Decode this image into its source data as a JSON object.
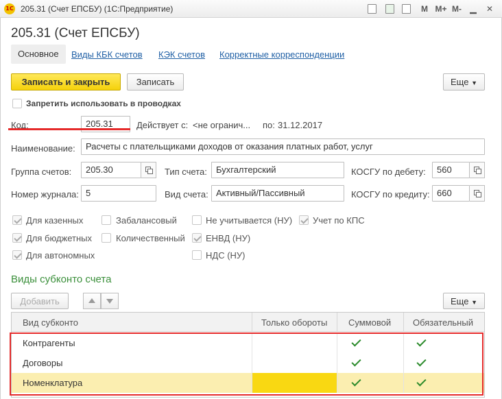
{
  "window": {
    "title": "205.31 (Счет ЕПСБУ)  (1С:Предприятие)",
    "logo": "1С",
    "toolbar": {
      "m": "M",
      "mplus": "M+",
      "mminus": "M-"
    }
  },
  "form": {
    "heading": "205.31 (Счет ЕПСБУ)",
    "tabs": [
      "Основное",
      "Виды КБК счетов",
      "КЭК счетов",
      "Корректные корреспонденции"
    ],
    "buttons": {
      "save_close": "Записать и закрыть",
      "save": "Записать",
      "more": "Еще"
    },
    "prohibit_label": "Запретить использовать в проводках",
    "code_label": "Код:",
    "code_value": "205.31",
    "valid_label": "Действует с:",
    "valid_from": "<не огранич...",
    "valid_to_label": "по:",
    "valid_to": "31.12.2017",
    "name_label": "Наименование:",
    "name_value": "Расчеты с плательщиками доходов от оказания платных работ, услуг",
    "group_label": "Группа счетов:",
    "group_value": "205.30",
    "type_label": "Тип счета:",
    "type_value": "Бухгалтерский",
    "kosgu_debit_label": "КОСГУ по дебету:",
    "kosgu_debit_value": "560",
    "journal_label": "Номер журнала:",
    "journal_value": "5",
    "kind_label": "Вид счета:",
    "kind_value": "Активный/Пассивный",
    "kosgu_credit_label": "КОСГУ по кредиту:",
    "kosgu_credit_value": "660",
    "checkboxes": [
      {
        "label": "Для казенных",
        "checked": true
      },
      {
        "label": "Забалансовый",
        "checked": false
      },
      {
        "label": "Не учитывается (НУ)",
        "checked": false
      },
      {
        "label": "Учет по КПС",
        "checked": true
      },
      {
        "label": "Для бюджетных",
        "checked": true
      },
      {
        "label": "Количественный",
        "checked": false
      },
      {
        "label": "ЕНВД (НУ)",
        "checked": true
      },
      {
        "label": "Для автономных",
        "checked": true
      },
      {
        "label": "НДС (НУ)",
        "checked": false
      }
    ],
    "subconto_title": "Виды субконто счета",
    "add_button": "Добавить",
    "more2": "Еще",
    "table": {
      "columns": [
        "Вид субконто",
        "Только обороты",
        "Суммовой",
        "Обязательный"
      ],
      "rows": [
        {
          "name": "Контрагенты",
          "only_turnover": false,
          "sum": true,
          "required": true
        },
        {
          "name": "Договоры",
          "only_turnover": false,
          "sum": true,
          "required": true
        },
        {
          "name": "Номенклатура",
          "only_turnover": false,
          "sum": true,
          "required": true
        }
      ]
    }
  }
}
